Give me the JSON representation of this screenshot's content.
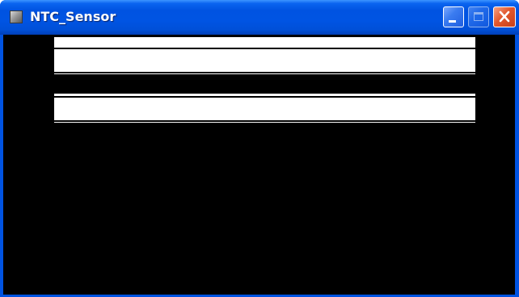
{
  "window": {
    "title": "NTC_Sensor"
  },
  "controls": {
    "minimize_icon": "minimize-icon",
    "maximize_icon": "maximize-icon",
    "close_icon": "close-icon"
  },
  "colors": {
    "titlebar": "#0054e3",
    "client_background": "#000000",
    "indicator_fill": "#ffffff",
    "close_button": "#e2572d"
  }
}
